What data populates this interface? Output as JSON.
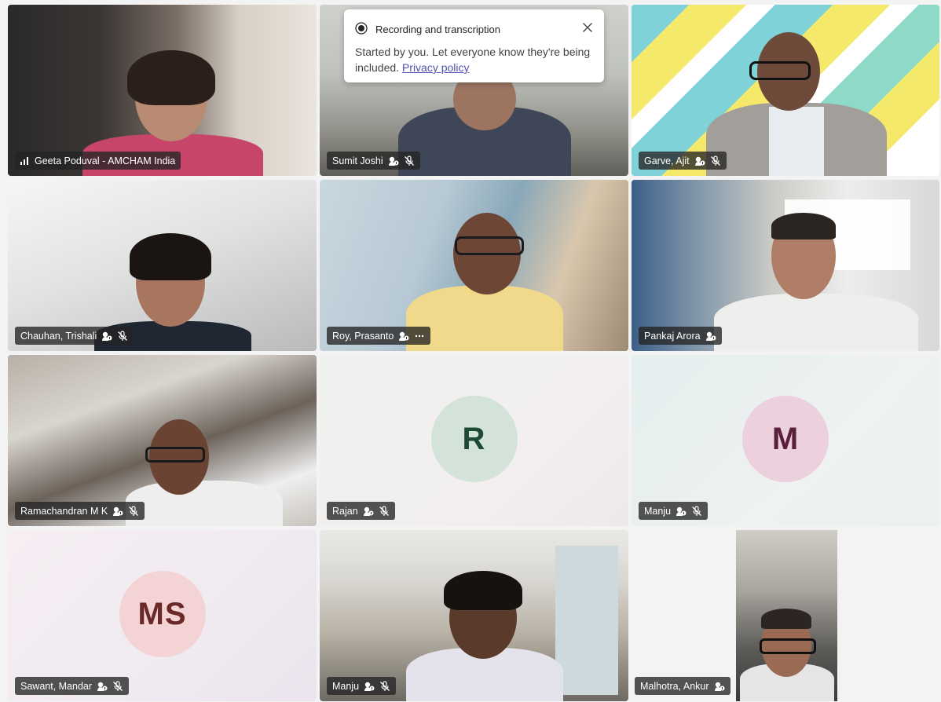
{
  "recording": {
    "title": "Recording and transcription",
    "message": "Started by you. Let everyone know they're being included.",
    "link": "Privacy policy"
  },
  "participants": [
    {
      "name": "Geeta Poduval - AMCHAM India",
      "indicator": "signal-bars-icon",
      "video": true
    },
    {
      "name": "Sumit Joshi",
      "indicator": "audio-unmuted-icon",
      "muted": true,
      "video": true
    },
    {
      "name": "Garve, Ajit",
      "indicator": "audio-unmuted-icon",
      "muted": true,
      "video": true
    },
    {
      "name": "Chauhan, Trishali",
      "indicator": "audio-unmuted-icon",
      "muted": true,
      "video": true
    },
    {
      "name": "Roy, Prasanto",
      "indicator": "audio-unmuted-icon",
      "more": true,
      "video": true
    },
    {
      "name": "Pankaj Arora",
      "indicator": "audio-unmuted-icon",
      "video": true
    },
    {
      "name": "Ramachandran M K",
      "indicator": "audio-unmuted-icon",
      "muted": true,
      "video": true
    },
    {
      "name": "Rajan",
      "initials": "R",
      "indicator": "audio-unmuted-icon",
      "muted": true,
      "video": false
    },
    {
      "name": "Manju",
      "initials": "M",
      "indicator": "audio-unmuted-icon",
      "muted": true,
      "video": false
    },
    {
      "name": "Sawant, Mandar",
      "initials": "MS",
      "indicator": "audio-unmuted-icon",
      "muted": true,
      "video": false
    },
    {
      "name": "Manju",
      "indicator": "audio-unmuted-icon",
      "muted": true,
      "video": true
    },
    {
      "name": "Malhotra, Ankur",
      "indicator": "audio-unmuted-icon",
      "video": true
    }
  ],
  "colors": {
    "avatar_r_bg": "#d3e3da",
    "avatar_r_fg": "#1e4a33",
    "avatar_m_bg": "#ecd0de",
    "avatar_m_fg": "#5a1f3c",
    "avatar_ms_bg": "#f3d3d3",
    "avatar_ms_fg": "#6a2828",
    "link": "#4f52b2"
  }
}
